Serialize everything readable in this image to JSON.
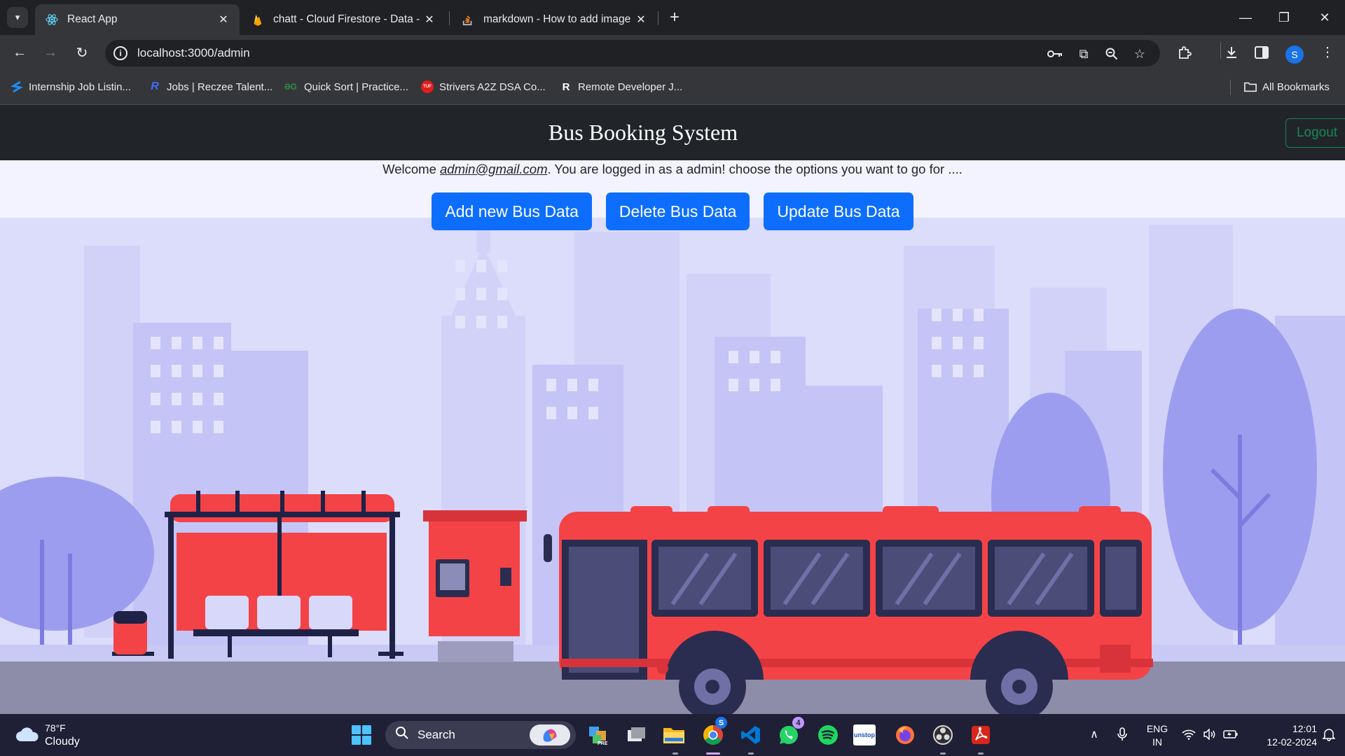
{
  "browser": {
    "tabs": [
      {
        "title": "React App",
        "active": true,
        "icon": "react-icon"
      },
      {
        "title": "chatt - Cloud Firestore - Data -",
        "active": false,
        "icon": "firebase-icon"
      },
      {
        "title": "markdown - How to add image",
        "active": false,
        "icon": "stackoverflow-icon"
      }
    ],
    "url": "localhost:3000/admin",
    "profile_initial": "S",
    "bookmarks": [
      {
        "label": "Internship Job Listin...",
        "icon": "unstop-icon"
      },
      {
        "label": "Jobs | Reczee Talent...",
        "icon": "reczee-icon"
      },
      {
        "label": "Quick Sort | Practice...",
        "icon": "gfg-icon"
      },
      {
        "label": "Strivers A2Z DSA Co...",
        "icon": "tuf-icon",
        "glyph": "TUF"
      },
      {
        "label": "Remote Developer J...",
        "icon": "remote-icon",
        "glyph": "R"
      }
    ],
    "all_bookmarks": "All Bookmarks"
  },
  "app": {
    "brand": "Bus Booking System",
    "logout_label": "Logout",
    "welcome_prefix": "Welcome ",
    "welcome_email": "admin@gmail.com",
    "welcome_suffix": ". You are logged in as a admin! choose the options you want to go for ....",
    "actions": [
      "Add new Bus Data",
      "Delete Bus Data",
      "Update Bus Data"
    ]
  },
  "taskbar": {
    "temperature": "78°F",
    "condition": "Cloudy",
    "search_label": "Search",
    "whatsapp_badge": "4",
    "chrome_badge": "S",
    "unstop_label": "unstop",
    "lang_top": "ENG",
    "lang_bottom": "IN",
    "time": "12:01",
    "date": "12-02-2024"
  },
  "colors": {
    "primary_button": "#0d6efd",
    "navbar": "#212529",
    "logout_outline": "#198754",
    "bus_red": "#f44346",
    "scene_violet": "#8a8ae8"
  }
}
